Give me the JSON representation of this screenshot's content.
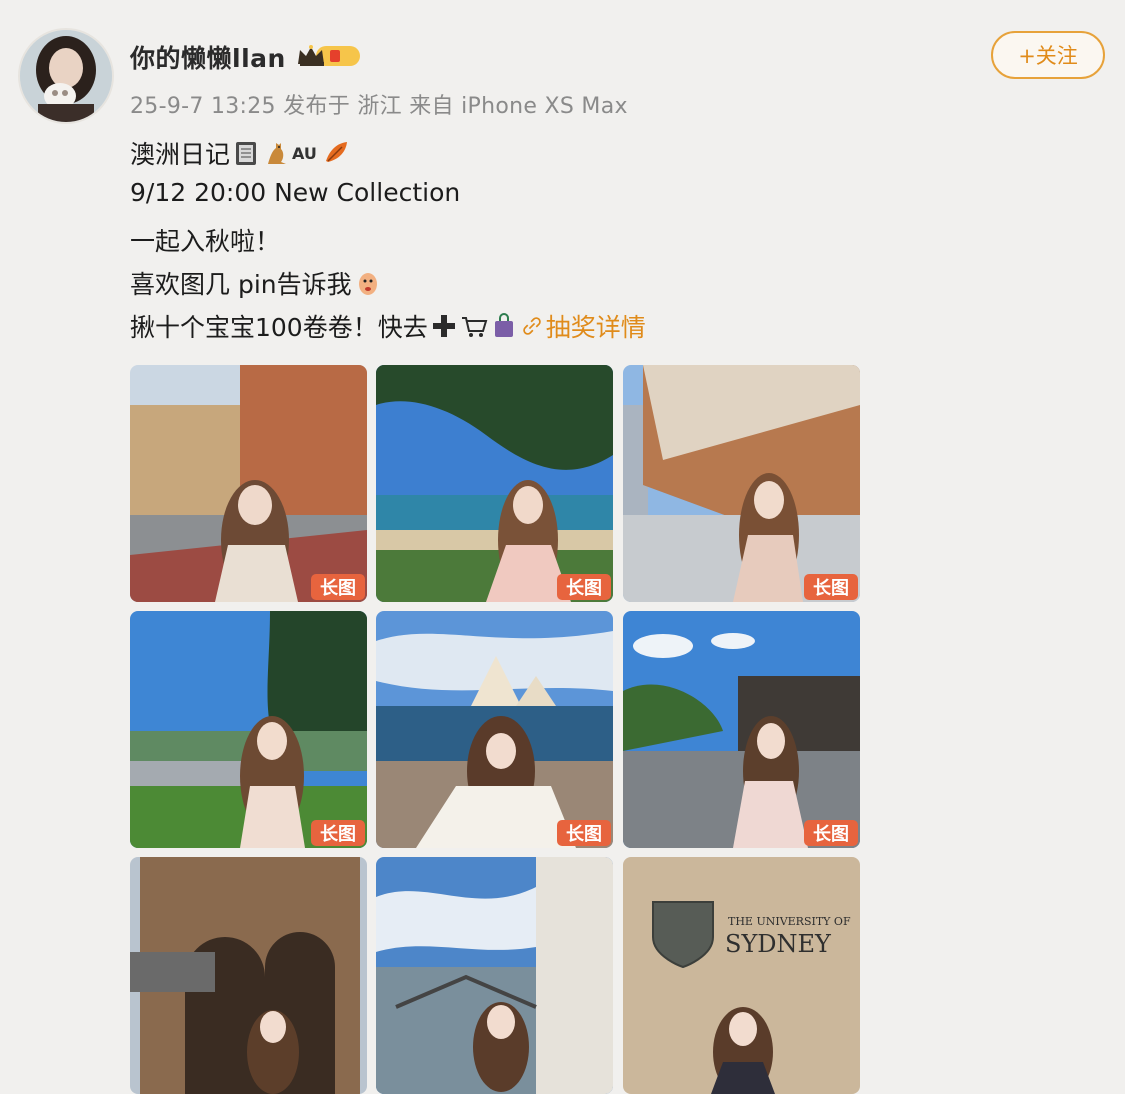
{
  "user": {
    "name": "你的懒懒llan",
    "crown_icon": "crown-icon",
    "level_badge": "vip-level-badge",
    "meta": "25-9-7 13:25 发布于 浙江 来自 iPhone XS Max"
  },
  "follow_label": "+关注",
  "post_lines": {
    "line1_text": "澳洲日记",
    "line1_au": "AU",
    "line2": "9/12 20:00 New Collection",
    "line3": "一起入秋啦！",
    "line4": "喜欢图几 pin告诉我",
    "line5_text": "揪十个宝宝100卷卷！快去",
    "lottery_link": "抽奖详情"
  },
  "photo_badge": "长图",
  "photos": [
    {
      "name": "photo-1",
      "long": true
    },
    {
      "name": "photo-2",
      "long": true
    },
    {
      "name": "photo-3",
      "long": true
    },
    {
      "name": "photo-4",
      "long": true
    },
    {
      "name": "photo-5",
      "long": true
    },
    {
      "name": "photo-6",
      "long": true
    },
    {
      "name": "photo-7",
      "long": false
    },
    {
      "name": "photo-8",
      "long": false
    },
    {
      "name": "photo-9",
      "long": false
    }
  ],
  "photo9_sign": {
    "line1": "THE UNIVERSITY OF",
    "line2": "SYDNEY"
  },
  "colors": {
    "accent": "#e08b1a",
    "badge": "#e7643e",
    "background": "#f1f0ee"
  }
}
